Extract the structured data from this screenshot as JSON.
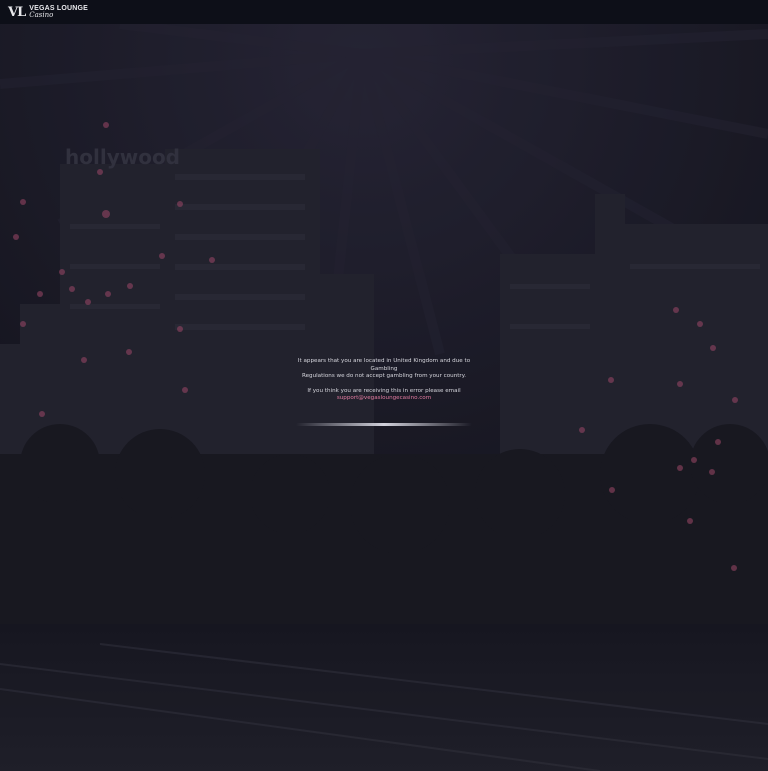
{
  "header": {
    "logo_mark": "VL",
    "logo_title": "VEGAS LOUNGE",
    "logo_subtitle": "Casino"
  },
  "background": {
    "sign_text": "hollywood"
  },
  "notice": {
    "line1": "It appears that you are located in United Kingdom and due to Gambling",
    "line2": "Regulations we do not accept gambling from your country.",
    "line3": "If you think you are receiving this in error please email",
    "email": "support@vegasloungecasino.com"
  },
  "colors": {
    "accent": "#e27ba0",
    "topbar": "#0d0f18",
    "background": "#1a1a26"
  }
}
